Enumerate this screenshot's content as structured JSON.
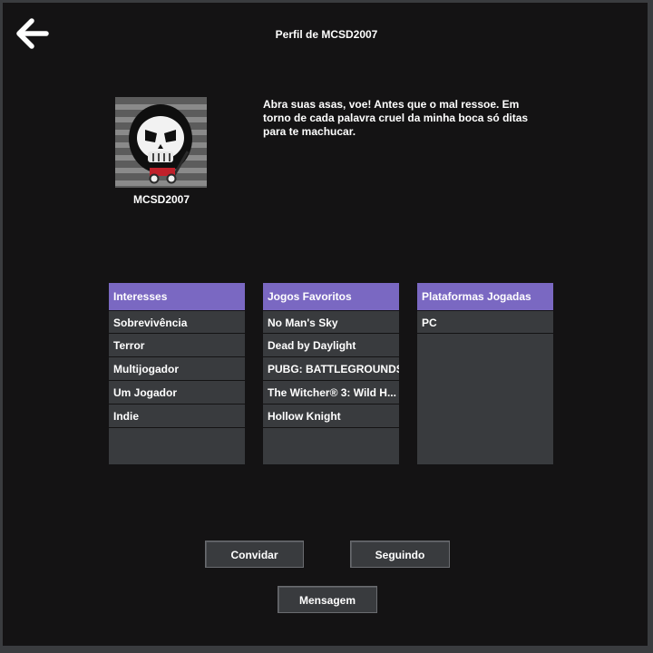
{
  "header": {
    "title": "Perfil de MCSD2007",
    "back_icon": "arrow-left-icon"
  },
  "profile": {
    "username": "MCSD2007",
    "bio": "Abra suas asas, voe! Antes que o mal ressoe. Em torno de cada palavra cruel da minha boca só ditas para te machucar."
  },
  "panels": {
    "interests": {
      "header": "Interesses",
      "items": [
        "Sobrevivência",
        "Terror",
        "Multijogador",
        "Um Jogador",
        "Indie"
      ]
    },
    "games": {
      "header": "Jogos Favoritos",
      "items": [
        "No Man's Sky",
        "Dead by Daylight",
        "PUBG: BATTLEGROUNDS",
        "The Witcher® 3: Wild H...",
        "Hollow Knight"
      ]
    },
    "platforms": {
      "header": "Plataformas Jogadas",
      "items": [
        "PC"
      ]
    }
  },
  "actions": {
    "invite": "Convidar",
    "following": "Seguindo",
    "message": "Mensagem"
  },
  "colors": {
    "background": "#141314",
    "panel": "#393b3e",
    "accent": "#7a68c2"
  }
}
